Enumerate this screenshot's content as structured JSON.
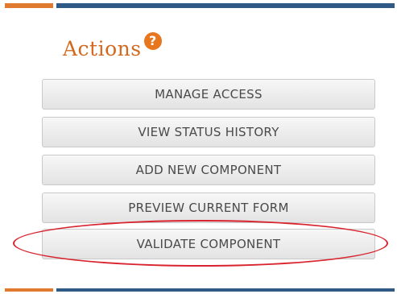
{
  "actions_panel": {
    "title": "Actions",
    "help_icon": "question-icon",
    "help_symbol": "?",
    "buttons": [
      {
        "label": "MANAGE ACCESS"
      },
      {
        "label": "VIEW STATUS HISTORY"
      },
      {
        "label": "ADD NEW COMPONENT"
      },
      {
        "label": "PREVIEW CURRENT FORM"
      },
      {
        "label": "VALIDATE COMPONENT"
      }
    ],
    "highlighted_button": "VALIDATE COMPONENT"
  },
  "colors": {
    "title": "#d2691e",
    "help_icon": "#e8761e",
    "accent_blue": "#2f5a86",
    "accent_orange": "#e07a2e",
    "highlight": "#d9232e"
  }
}
